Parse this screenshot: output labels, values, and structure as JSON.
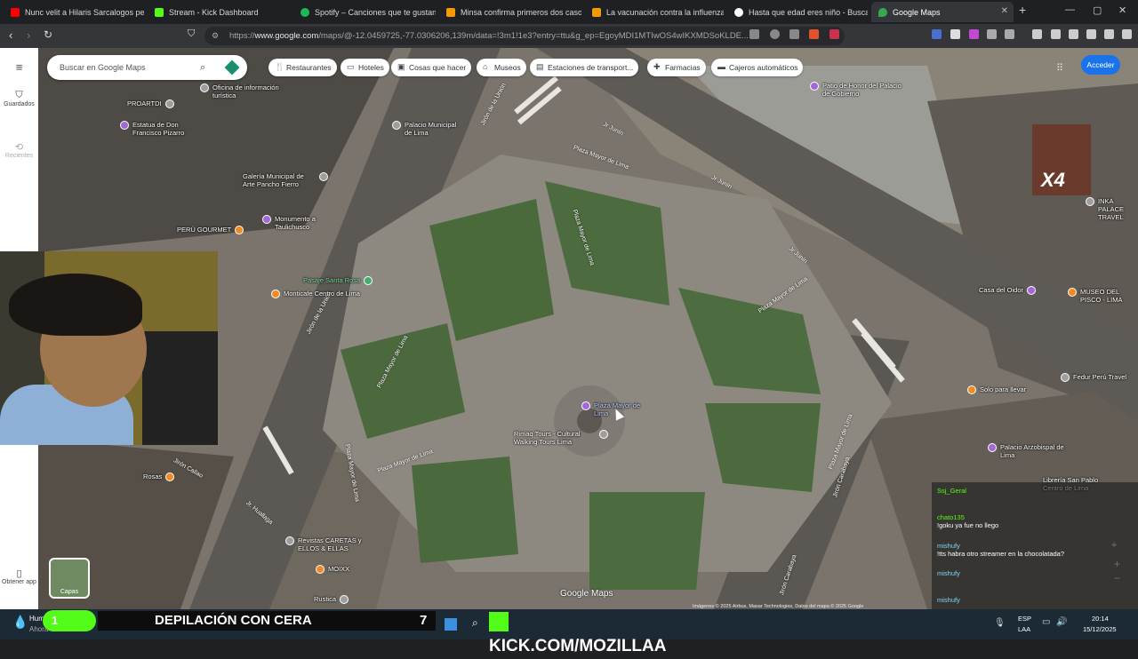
{
  "tabs": [
    {
      "label": "Nunc velit a Hilaris Sarcalogos per",
      "color": "#ff0000"
    },
    {
      "label": "Stream - Kick Dashboard",
      "color": "#53fc18"
    },
    {
      "label": "Spotify – Canciones que te gustan",
      "color": "#1db954"
    },
    {
      "label": "Minsa confirma primeros dos casos",
      "color": "#f59b00"
    },
    {
      "label": "La vacunación contra la influenza A",
      "color": "#f59b00"
    },
    {
      "label": "Hasta que edad eres niño - Buscar",
      "color": "#ffffff"
    },
    {
      "label": "Google Maps",
      "color": "#34a853",
      "active": true
    }
  ],
  "address": {
    "url_prefix": "https://",
    "url_host": "www.google.com",
    "url_path": "/maps/@-12.0459725,-77.0306206,139m/data=!3m1!1e3?entry=ttu&g_ep=EgoyMDI1MTIwOS4wIKXMDSoKLDE..."
  },
  "rail": {
    "menu_icon": "hamburger-icon",
    "saved_label": "Guardados",
    "recent_label": "Recientes",
    "get_app_label": "Obtener app"
  },
  "search": {
    "placeholder": "Buscar en Google Maps"
  },
  "chips": [
    {
      "label": "Restaurantes",
      "icon": "restaurant-icon"
    },
    {
      "label": "Hoteles",
      "icon": "hotel-icon"
    },
    {
      "label": "Cosas que hacer",
      "icon": "camera-icon"
    },
    {
      "label": "Museos",
      "icon": "museum-icon"
    },
    {
      "label": "Estaciones de transport...",
      "icon": "transit-icon"
    },
    {
      "label": "Farmacias",
      "icon": "pharmacy-icon"
    },
    {
      "label": "Cajeros automáticos",
      "icon": "atm-icon"
    }
  ],
  "signin_label": "Acceder",
  "layers_label": "Capas",
  "google_watermark": "Google Maps",
  "attribution": "Imágenes © 2025 Airbus, Maxar Technologies, Datos del mapa © 2025 Google",
  "pois": [
    {
      "label": "Oficina de información turística",
      "color": "#9e9e9e"
    },
    {
      "label": "PROARTDI",
      "color": "#9e9e9e"
    },
    {
      "label": "Estatua de Don Francisco Pizarro",
      "color": "#a368d8"
    },
    {
      "label": "Palacio Municipal de Lima",
      "color": "#9e9e9e"
    },
    {
      "label": "Galería Municipal de Arte Pancho Fierro",
      "color": "#9e9e9e"
    },
    {
      "label": "Monumento a Taulichusco",
      "color": "#a368d8"
    },
    {
      "label": "PERÚ GOURMET",
      "color": "#f08a24"
    },
    {
      "label": "Pasaje Santa Rosa",
      "color": "#3fae6f"
    },
    {
      "label": "Monticafe Centro de Lima",
      "color": "#f08a24"
    },
    {
      "label": "Plaza Mayor de Lima",
      "color": "#a368d8"
    },
    {
      "label": "Rimaq Tours - Cultural Walking Tours Lima",
      "color": "#9e9e9e"
    },
    {
      "label": "Patio de Honor del Palacio de Gobierno",
      "color": "#a368d8"
    },
    {
      "label": "Casa del Oidor",
      "color": "#a368d8"
    },
    {
      "label": "MUSEO DEL PISCO - LIMA",
      "color": "#f08a24"
    },
    {
      "label": "Fedur Perú Travel",
      "color": "#9e9e9e"
    },
    {
      "label": "Solo para llevar",
      "color": "#f08a24"
    },
    {
      "label": "Palacio Arzobispal de Lima",
      "color": "#a368d8"
    },
    {
      "label": "Librería San Pablo Centro de Lima",
      "color": "#4fa0e0"
    },
    {
      "label": "INKA PALACE TRAVEL",
      "color": "#9e9e9e"
    },
    {
      "label": "Revistas CARETAS y ELLOS & ELLAS",
      "color": "#9e9e9e"
    },
    {
      "label": "MOIXX",
      "color": "#f08a24"
    },
    {
      "label": "Rosas",
      "color": "#f08a24"
    },
    {
      "label": "Rustica",
      "color": "#9e9e9e"
    }
  ],
  "streets": [
    "Jirón de la Unión",
    "Jr Junín",
    "Plaza Mayor de Lima",
    "Jirón Carabaya",
    "Jirón Callao",
    "Jr. Huallaga"
  ],
  "chat": [
    {
      "user": "Ssj_Geral",
      "text": ""
    },
    {
      "user": "chato135",
      "text": "!goku ya fue no llego"
    },
    {
      "user": "mishufy",
      "text": "!tts habra otro streamer en la chocolatada?"
    },
    {
      "user": "mishufy",
      "text": ""
    },
    {
      "user": "mishufy",
      "text": ""
    },
    {
      "user": "mishufy",
      "text": ""
    }
  ],
  "overlay": {
    "badge_number": "1",
    "banner_text": "DEPILACIÓN CON CERA",
    "banner_count": "7",
    "kick_text": "KICK.COM/MOZILLAA",
    "emote_text": "X4"
  },
  "taskbar": {
    "weather": "Hum",
    "weather_sub": "Ahora",
    "lang": "ESP",
    "lang_sub": "LAA",
    "time": "20:14",
    "date": "15/12/2025"
  }
}
